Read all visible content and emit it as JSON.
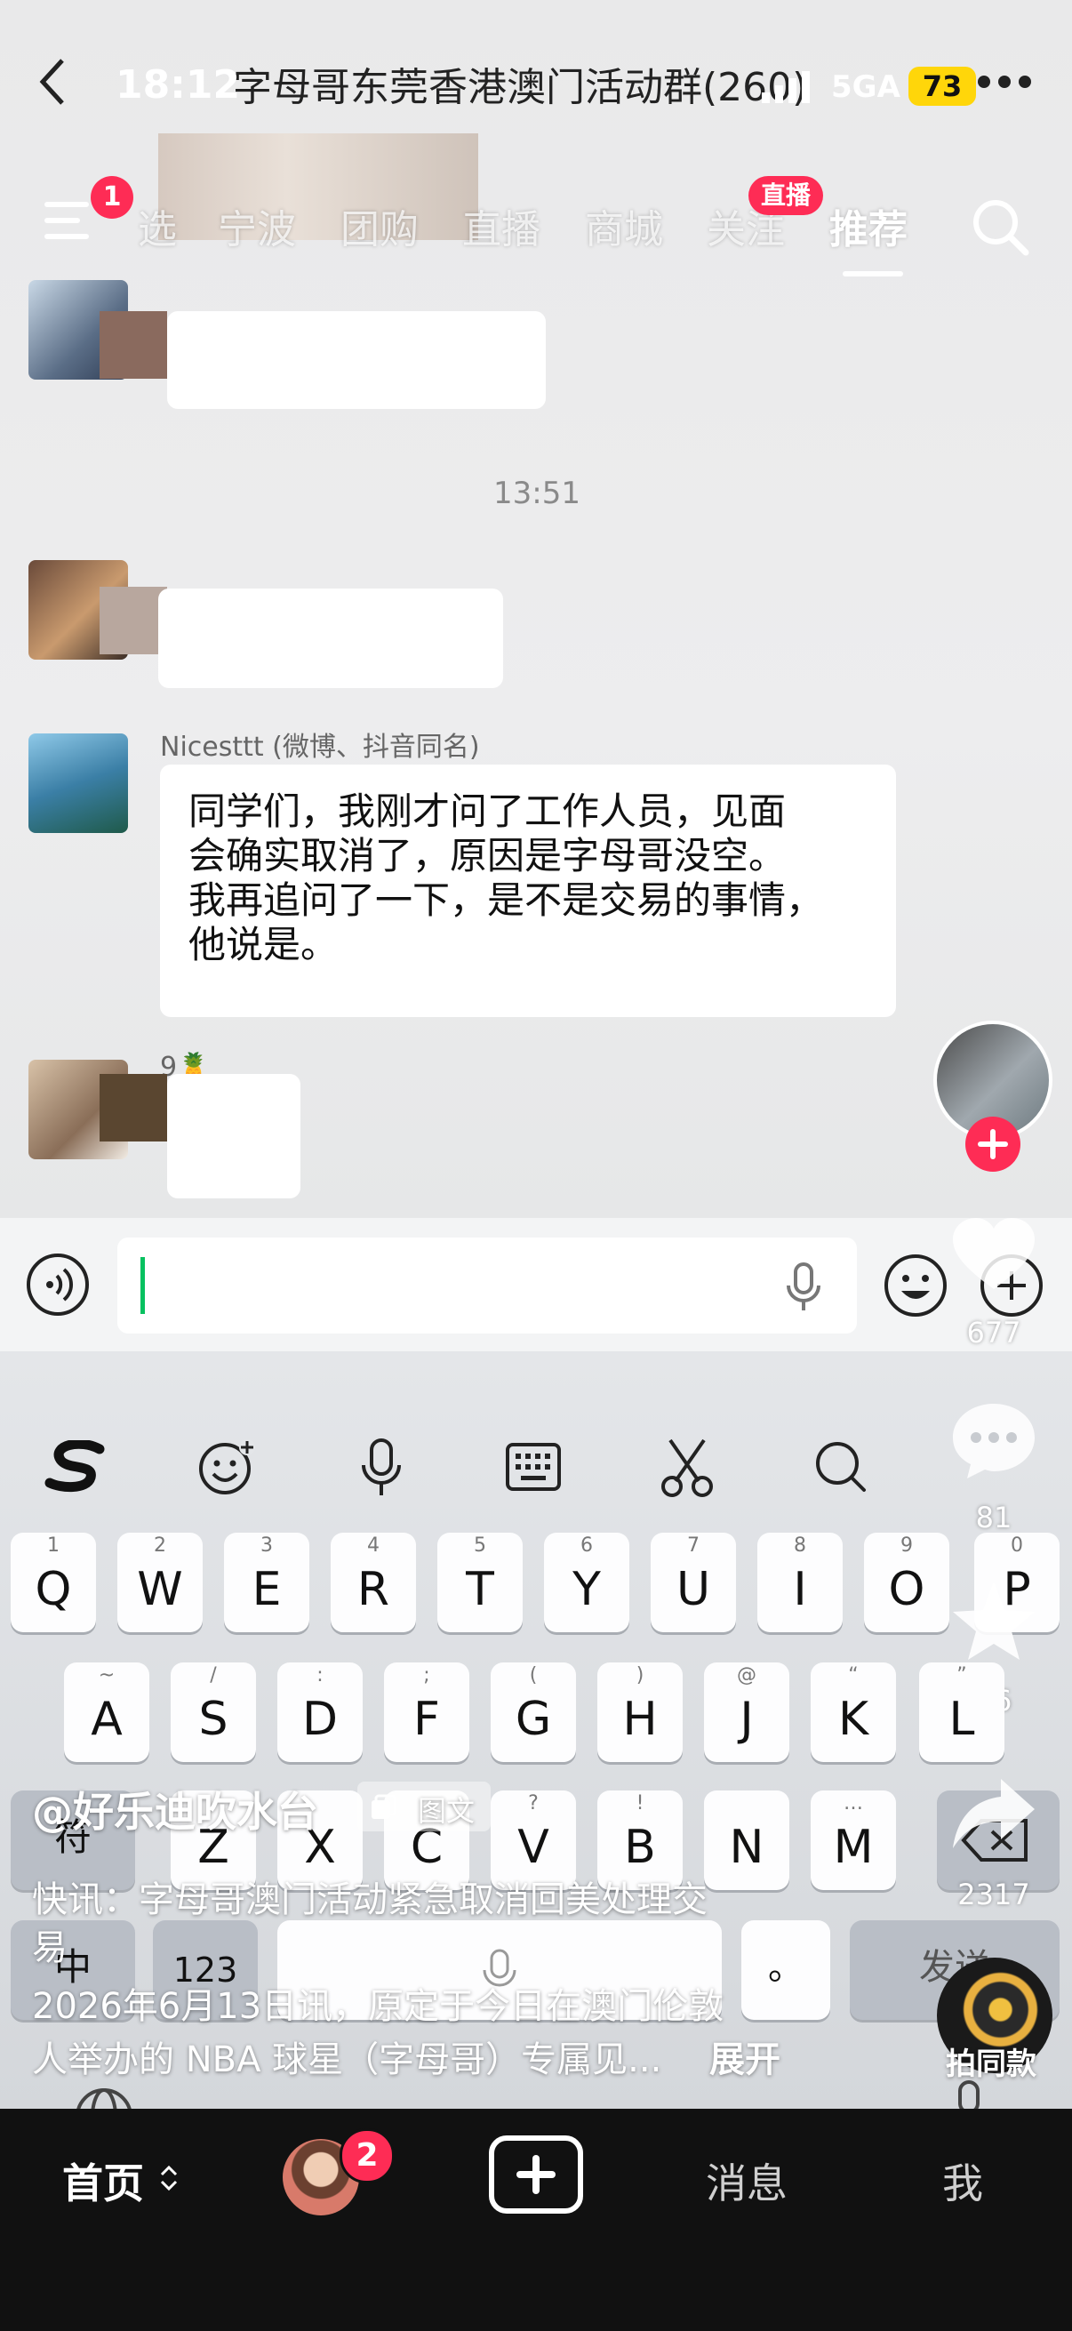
{
  "status_bar": {
    "time": "18:12",
    "network": "5GA",
    "battery": "73"
  },
  "chat_header": {
    "title": "字母哥东莞香港澳门活动群(260)"
  },
  "top_tabs": {
    "menu_badge": "1",
    "items": [
      {
        "label": "选"
      },
      {
        "label": "宁波"
      },
      {
        "label": "团购"
      },
      {
        "label": "直播"
      },
      {
        "label": "商城"
      },
      {
        "label": "关注"
      },
      {
        "label": "推荐"
      }
    ],
    "live_badge": "直播"
  },
  "chat": {
    "timestamp": "13:51",
    "message": {
      "sender": "Nicesttt (微博、抖音同名)",
      "text_lines": [
        "同学们，我刚才问了工作人员，见面",
        "会确实取消了，原因是字母哥没空。",
        "我再追问了一下，是不是交易的事情，",
        "他说是。"
      ]
    },
    "next_sender": "9🍍"
  },
  "keyboard_toolbar": [
    "sogou-logo-icon",
    "emoji-add-icon",
    "mic-icon",
    "keyboard-icon",
    "scissors-icon",
    "search-icon"
  ],
  "keyboard": {
    "row1": [
      {
        "hint": "1",
        "key": "Q"
      },
      {
        "hint": "2",
        "key": "W"
      },
      {
        "hint": "3",
        "key": "E"
      },
      {
        "hint": "4",
        "key": "R"
      },
      {
        "hint": "5",
        "key": "T"
      },
      {
        "hint": "6",
        "key": "Y"
      },
      {
        "hint": "7",
        "key": "U"
      },
      {
        "hint": "8",
        "key": "I"
      },
      {
        "hint": "9",
        "key": "O"
      },
      {
        "hint": "0",
        "key": "P"
      }
    ],
    "row2": [
      {
        "hint": "~",
        "key": "A"
      },
      {
        "hint": "/",
        "key": "S"
      },
      {
        "hint": ":",
        "key": "D"
      },
      {
        "hint": ";",
        "key": "F"
      },
      {
        "hint": "(",
        "key": "G"
      },
      {
        "hint": ")",
        "key": "H"
      },
      {
        "hint": "@",
        "key": "J"
      },
      {
        "hint": "“",
        "key": "K"
      },
      {
        "hint": "”",
        "key": "L"
      }
    ],
    "row3": [
      {
        "hint": "",
        "key": "Z"
      },
      {
        "hint": "",
        "key": "X"
      },
      {
        "hint": "",
        "key": "C"
      },
      {
        "hint": "?",
        "key": "V"
      },
      {
        "hint": "!",
        "key": "B"
      },
      {
        "hint": "",
        "key": "N"
      },
      {
        "hint": "…",
        "key": "M"
      }
    ],
    "symbol_key": "符",
    "lang_key": "中",
    "num_key": "123",
    "send_key": "发送",
    "period_key": "。"
  },
  "side_actions": {
    "likes": "677",
    "comments": "81",
    "favorites": "46",
    "shares": "2317",
    "same_style": "拍同款"
  },
  "post": {
    "author": "@好乐迪吹水台",
    "type_tag": "图文",
    "headline_lines": [
      "快讯：字母哥澳门活动紧急取消回美处理交",
      "易"
    ],
    "desc_lines": [
      "2026年6月13日讯，原定于今日在澳门伦敦",
      "人举办的 NBA 球星（字母哥）专属见..."
    ],
    "expand": "展开"
  },
  "bottom_nav": {
    "home": "首页",
    "friends_badge": "2",
    "messages": "消息",
    "me": "我"
  },
  "colors": {
    "accent_red": "#fe2c55",
    "nav_bg": "#111111",
    "caret_green": "#07c160"
  }
}
